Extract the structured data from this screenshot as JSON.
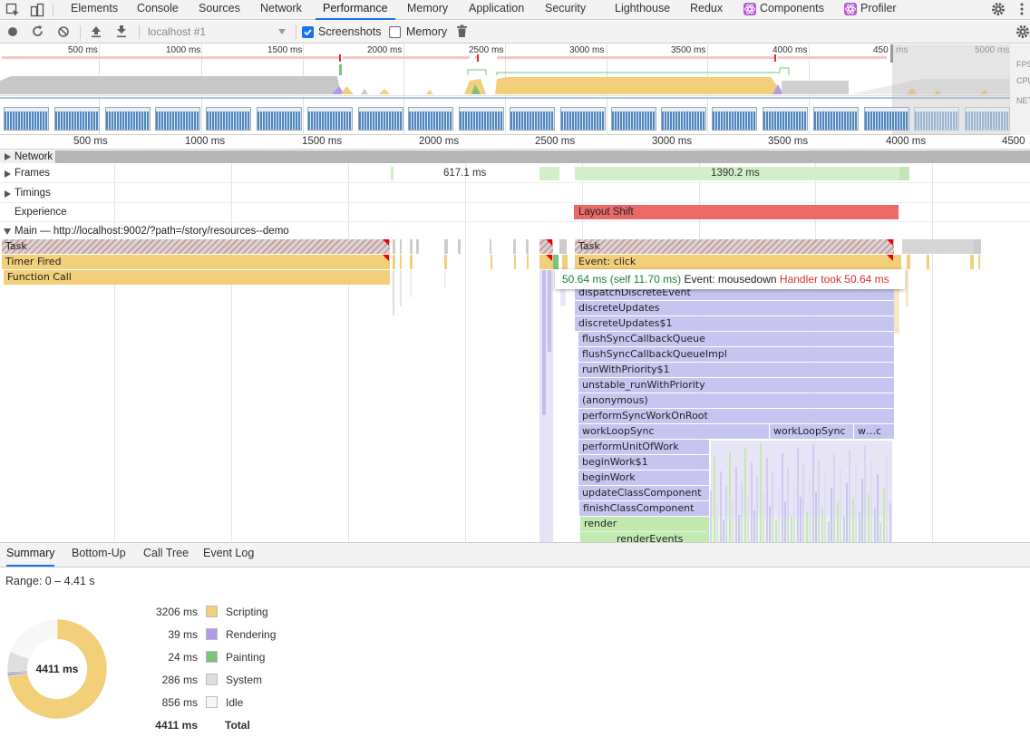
{
  "tabs": [
    {
      "label": "Elements",
      "active": false
    },
    {
      "label": "Console",
      "active": false
    },
    {
      "label": "Sources",
      "active": false
    },
    {
      "label": "Network",
      "active": false
    },
    {
      "label": "Performance",
      "active": true
    },
    {
      "label": "Memory",
      "active": false
    },
    {
      "label": "Application",
      "active": false
    },
    {
      "label": "Security",
      "active": false
    },
    {
      "label": "Lighthouse",
      "active": false
    },
    {
      "label": "Redux",
      "active": false
    },
    {
      "label": "Components",
      "active": false
    },
    {
      "label": "Profiler",
      "active": false
    }
  ],
  "toolbar": {
    "target": "localhost #1",
    "screenshots_label": "Screenshots",
    "screenshots_checked": true,
    "memory_label": "Memory",
    "memory_checked": false
  },
  "overview": {
    "ticks": [
      "500 ms",
      "1000 ms",
      "1500 ms",
      "2000 ms",
      "2500 ms",
      "3000 ms",
      "3500 ms",
      "4000 ms",
      "450",
      "ms",
      "5000 ms"
    ],
    "labels": {
      "fps": "FPS",
      "cpu": "CPU",
      "net": "NET"
    }
  },
  "ruler_ticks": [
    "500 ms",
    "1000 ms",
    "1500 ms",
    "2000 ms",
    "2500 ms",
    "3000 ms",
    "3500 ms",
    "4000 ms",
    "4500"
  ],
  "tracks": {
    "network": "Network",
    "frames": "Frames",
    "frame_1": "617.1 ms",
    "frame_2": "1390.2 ms",
    "timings": "Timings",
    "experience": "Experience",
    "layout_shift": "Layout Shift",
    "main": "Main — http://localhost:9002/?path=/story/resources--demo"
  },
  "flame": {
    "left": [
      "Task",
      "Timer Fired",
      "Function Call"
    ],
    "right": [
      "Task",
      "Event: click",
      "dispatchDiscreteEvent",
      "discreteUpdates",
      "discreteUpdates$1",
      "flushSyncCallbackQueue",
      "flushSyncCallbackQueueImpl",
      "runWithPriority$1",
      "unstable_runWithPriority",
      "(anonymous)",
      "performSyncWorkOnRoot",
      "workLoopSync",
      "performUnitOfWork",
      "beginWork$1",
      "beginWork",
      "updateClassComponent",
      "finishClassComponent",
      "render",
      "renderEvents"
    ],
    "extra": [
      "workLoopSync",
      "w…c"
    ]
  },
  "tooltip": {
    "duration": "50.64 ms (self 11.70 ms)",
    "event": "Event: mousedown",
    "warning": "Handler took 50.64 ms"
  },
  "bottom_tabs": [
    {
      "label": "Summary",
      "active": true
    },
    {
      "label": "Bottom-Up",
      "active": false
    },
    {
      "label": "Call Tree",
      "active": false
    },
    {
      "label": "Event Log",
      "active": false
    }
  ],
  "summary": {
    "range": "Range: 0 – 4.41 s",
    "center_label": "4411 ms",
    "total_ms": 4411,
    "items": [
      {
        "value": "3206 ms",
        "name": "Scripting",
        "ms": 3206,
        "color": "#f2cf79"
      },
      {
        "value": "39 ms",
        "name": "Rendering",
        "ms": 39,
        "color": "#af9ae8"
      },
      {
        "value": "24 ms",
        "name": "Painting",
        "ms": 24,
        "color": "#7ac37a"
      },
      {
        "value": "286 ms",
        "name": "System",
        "ms": 286,
        "color": "#dedede"
      },
      {
        "value": "856 ms",
        "name": "Idle",
        "ms": 856,
        "color": "#f7f7f7"
      }
    ],
    "total": {
      "value": "4411 ms",
      "name": "Total"
    }
  },
  "colors": {
    "accent": "#1a73e8",
    "scripting": "#f2cf79",
    "rendering": "#af9ae8",
    "painting": "#7ac37a",
    "warning": "#d93025",
    "layout_shift": "#ea6a6a",
    "frame": "#d2efc7"
  }
}
